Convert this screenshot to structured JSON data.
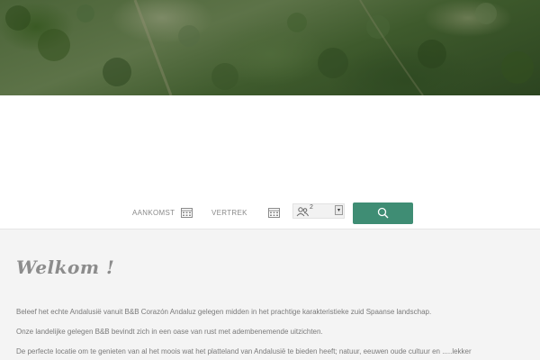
{
  "hero": {
    "image": "mountain-landscape"
  },
  "booking": {
    "arrival_label": "AANKOMST",
    "departure_label": "VERTREK",
    "guest_count": "2",
    "dropdown_glyph": "▾",
    "accent_color": "#3f8d74"
  },
  "welcome": {
    "title": "Welkom !",
    "paragraphs": [
      "Beleef het echte Andalusië vanuit B&B Corazón Andaluz gelegen midden in het prachtige karakteristieke zuid Spaanse landschap.",
      "Onze landelijke gelegen B&B bevindt zich in een oase van rust met adembenemende uitzichten.",
      "De perfecte locatie om te genieten van al het moois wat het platteland van Andalusië te bieden heeft; natuur, eeuwen oude cultuur en .....lekker"
    ]
  }
}
